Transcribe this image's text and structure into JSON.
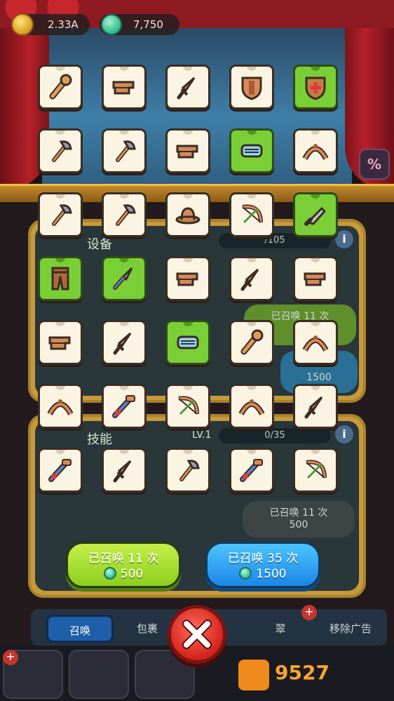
{
  "currency": {
    "gold": "2.33A",
    "gems": "7,750"
  },
  "panels": {
    "upgrade": {
      "title": "设备",
      "progress": "/105"
    },
    "skill": {
      "title": "技能",
      "level": "LV.1",
      "progress": "0/35"
    }
  },
  "background_buttons": {
    "upgrade_summon_label": "已召唤 11 次",
    "upgrade_cost": "1500",
    "skill_summon_label": "已召唤 11 次",
    "skill_cost": "500"
  },
  "summon_buttons": [
    {
      "label": "已召唤 11 次",
      "cost": "500",
      "color": "#8ccf1d"
    },
    {
      "label": "已召唤 35 次",
      "cost": "1500",
      "color": "#1c86e6"
    }
  ],
  "tabs": [
    {
      "label": "召唤",
      "active": true
    },
    {
      "label": "包裹",
      "active": false
    },
    {
      "label": "翠",
      "active": false
    },
    {
      "label": "移除广告",
      "active": false
    }
  ],
  "watermark": {
    "text": "9527"
  },
  "item_grid": [
    [
      "club-icon",
      "block-icon",
      "dagger-icon",
      "shield-icon",
      "green-shield-icon"
    ],
    [
      "axe-icon",
      "axe-icon",
      "block-icon",
      "mask-icon",
      "crown-icon"
    ],
    [
      "axe-icon",
      "axe-icon",
      "hat-icon",
      "bow-icon",
      "knife-icon"
    ],
    [
      "pants-icon",
      "spear-icon",
      "block-icon",
      "dagger-icon",
      "block-icon"
    ],
    [
      "block-icon",
      "dagger-icon",
      "mask-icon",
      "club-icon",
      "crown-icon"
    ],
    [
      "crown-icon",
      "gun-icon",
      "bow-icon",
      "crown-icon",
      "dagger-icon"
    ],
    [
      "gun-icon",
      "dagger-icon",
      "axe-icon",
      "gun-icon",
      "bow-icon"
    ]
  ],
  "green_cards": [
    [
      0,
      4
    ],
    [
      1,
      3
    ],
    [
      2,
      4
    ],
    [
      3,
      0
    ],
    [
      3,
      1
    ],
    [
      4,
      2
    ]
  ],
  "colors": {
    "card": "#fbf4e3",
    "card_green": "#7bcf36",
    "accent_red": "#d3231c"
  }
}
